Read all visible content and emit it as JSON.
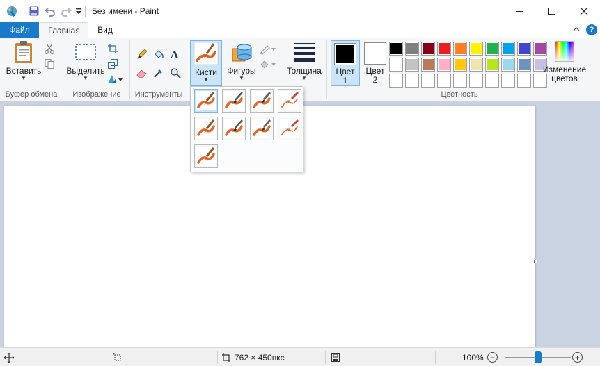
{
  "titlebar": {
    "title": "Без имени - Paint",
    "icons": [
      "paint-app-icon",
      "save-icon",
      "undo-icon",
      "redo-icon",
      "customize-dropdown-icon"
    ],
    "controls": [
      "minimize-icon",
      "maximize-icon",
      "close-icon"
    ]
  },
  "tabs": {
    "file": "Файл",
    "home": "Главная",
    "view": "Вид"
  },
  "ribbon": {
    "clipboard": {
      "paste": "Вставить",
      "group": "Буфер обмена"
    },
    "image": {
      "select": "Выделить",
      "group": "Изображение"
    },
    "tools": {
      "group": "Инструменты"
    },
    "brushes": {
      "label": "Кисти"
    },
    "shapes": {
      "label": "Фигуры"
    },
    "size": {
      "label": "Толщина"
    },
    "colors": {
      "color1": "Цвет",
      "color1_num": "1",
      "color2": "Цвет",
      "color2_num": "2",
      "edit_line1": "Изменение",
      "edit_line2": "цветов",
      "group": "Цветность",
      "color1_value": "#000000",
      "color2_value": "#ffffff",
      "palette": [
        "#000000",
        "#7f7f7f",
        "#880015",
        "#ed1c24",
        "#ff7f27",
        "#fff200",
        "#22b14c",
        "#00a2e8",
        "#3f48cc",
        "#a349a4",
        "#ffffff",
        "#c3c3c3",
        "#b97a57",
        "#ffaec9",
        "#ffc90e",
        "#efe4b0",
        "#b5e61d",
        "#99d9ea",
        "#7092be",
        "#c8bfe7"
      ]
    }
  },
  "brush_menu": {
    "items": [
      "brush",
      "calligraphy-brush-1",
      "calligraphy-brush-2",
      "airbrush",
      "oil-brush",
      "crayon",
      "marker",
      "natural-pencil",
      "watercolor-brush"
    ]
  },
  "status": {
    "dimensions": "762 × 450пкс",
    "zoom": "100%",
    "zoom_level": 0.5
  }
}
